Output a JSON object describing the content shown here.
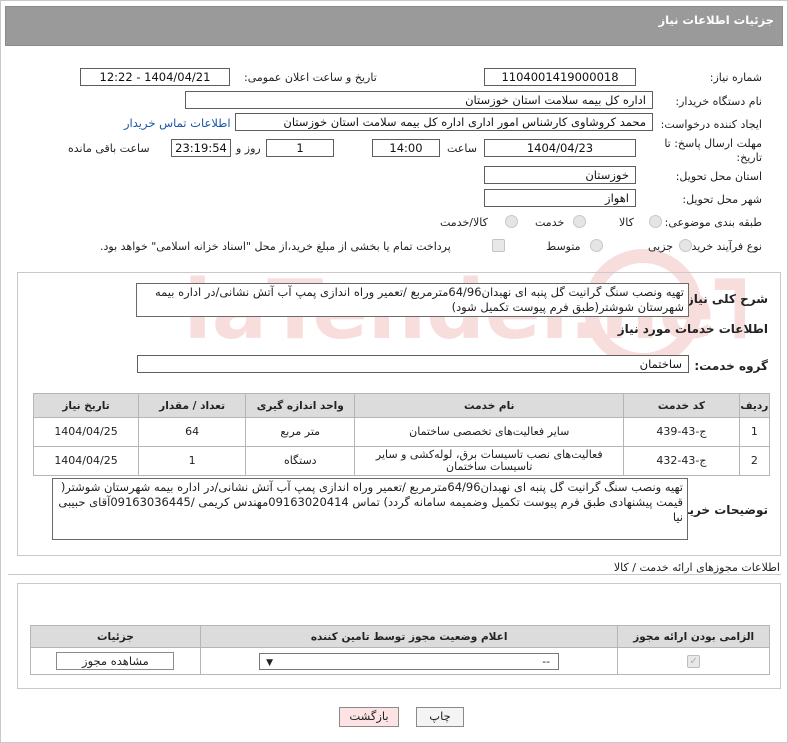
{
  "header": {
    "title": "جزئیات اطلاعات نیاز"
  },
  "form": {
    "need_number_label": "شماره نیاز:",
    "need_number": "1104001419000018",
    "announce_label": "تاریخ و ساعت اعلان عمومی:",
    "announce_value": "1404/04/21 - 12:22",
    "buyer_org_label": "نام دستگاه خریدار:",
    "buyer_org": "اداره کل بیمه سلامت استان خوزستان",
    "creator_label": "ایجاد کننده درخواست:",
    "creator": "محمد کروشاوی کارشناس امور اداری اداره کل بیمه سلامت استان خوزستان",
    "contact_link": "اطلاعات تماس خریدار",
    "deadline_label": "مهلت ارسال پاسخ: تا تاریخ:",
    "deadline_date": "1404/04/23",
    "time_label": "ساعت",
    "deadline_time": "14:00",
    "days_value": "1",
    "days_label": "روز و",
    "remaining_time": "23:19:54",
    "remaining_label": "ساعت باقی مانده",
    "province_label": "استان محل تحویل:",
    "province": "خوزستان",
    "city_label": "شهر محل تحویل:",
    "city": "اهواز",
    "category_label": "طبقه بندی موضوعی:",
    "category_options": [
      "کالا",
      "خدمت",
      "کالا/خدمت"
    ],
    "process_label": "نوع فرآیند خرید :",
    "process_options": [
      "جزیی",
      "متوسط"
    ],
    "payment_note": "پرداخت تمام یا بخشی از مبلغ خرید،از محل \"اسناد خزانه اسلامی\" خواهد بود."
  },
  "summary": {
    "label": "شرح کلی نیاز:",
    "text": "تهیه ونصب سنگ گرانیت گل پنبه ای نهبدان64/96مترمربع /تعمیر وراه اندازی پمپ آب آتش نشانی/در اداره بیمه شهرستان شوشتر(طبق فرم پیوست تکمیل شود)"
  },
  "services": {
    "section_title": "اطلاعات خدمات مورد نیاز",
    "group_label": "گروه خدمت:",
    "group_value": "ساختمان",
    "columns": [
      "ردیف",
      "کد خدمت",
      "نام خدمت",
      "واحد اندازه گیری",
      "تعداد / مقدار",
      "تاریخ نیاز"
    ],
    "rows": [
      {
        "row": "1",
        "code": "ج-43-439",
        "name": "سایر فعالیت‌های تخصصی ساختمان",
        "unit": "متر مربع",
        "qty": "64",
        "date": "1404/04/25"
      },
      {
        "row": "2",
        "code": "ج-43-432",
        "name": "فعالیت‌های نصب تاسیسات برق، لوله‌کشی و سایر تاسیسات ساختمان",
        "unit": "دستگاه",
        "qty": "1",
        "date": "1404/04/25"
      }
    ]
  },
  "buyer_notes": {
    "label": "توضیحات خریدار:",
    "text": "تهیه ونصب سنگ گرانیت گل پنبه ای نهبدان64/96مترمربع /تعمیر وراه اندازی پمپ آب آتش نشانی/در اداره بیمه شهرستان شوشتر( قیمت پیشنهادی طبق فرم پیوست تکمیل وضمیمه سامانه گردد) تماس 09163020414مهندس کریمی /09163036445آقای حبیبی نیا"
  },
  "permits": {
    "title": "اطلاعات مجوزهای ارائه خدمت / کالا",
    "columns": [
      "الزامی بودن ارائه مجوز",
      "اعلام وضعیت مجوز توسط تامین کننده",
      "جزئیات"
    ],
    "select_value": "--",
    "view_button": "مشاهده مجوز"
  },
  "footer": {
    "print_button": "چاپ",
    "back_button": "بازگشت"
  },
  "watermark": "AriaTender.neT",
  "colors": {
    "header_bg": "#9a9a9a",
    "link": "#1a56a8",
    "back_button_bg": "#fde3e3"
  }
}
